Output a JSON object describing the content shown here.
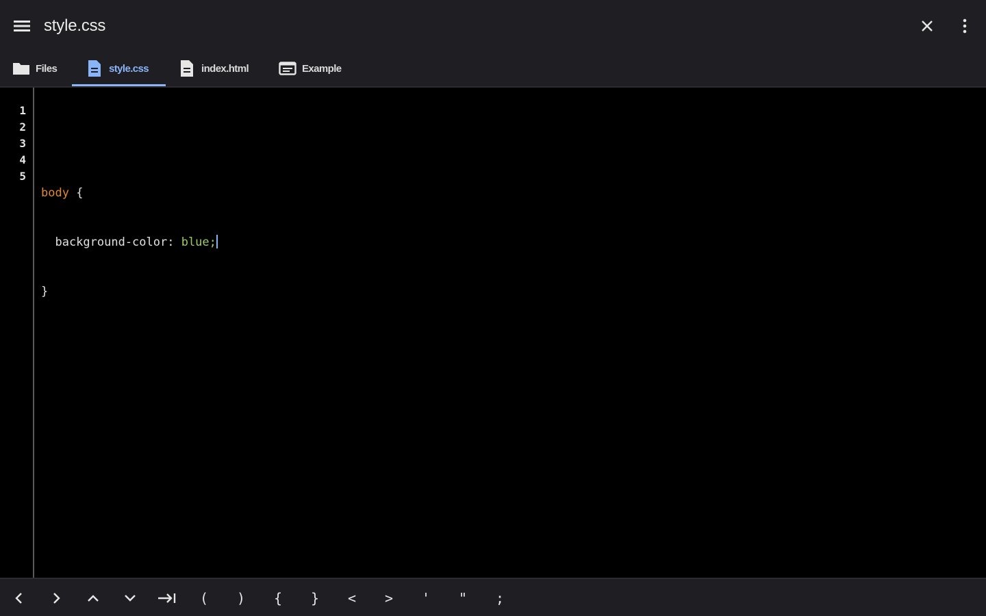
{
  "header": {
    "title": "style.css"
  },
  "tabs": [
    {
      "label": "Files",
      "icon": "folder-icon",
      "active": false
    },
    {
      "label": "style.css",
      "icon": "file-icon",
      "active": true
    },
    {
      "label": "index.html",
      "icon": "file-icon",
      "active": false
    },
    {
      "label": "Example",
      "icon": "preview-icon",
      "active": false
    }
  ],
  "editor": {
    "line_numbers": [
      "1",
      "2",
      "3",
      "4",
      "5"
    ],
    "code": {
      "line2_selector": "body",
      "line2_brace": " {",
      "line3_property": "  background-color: ",
      "line3_value": "blue;",
      "line4_brace": "}"
    }
  },
  "symbolbar": {
    "keys": [
      "left-arrow",
      "right-arrow",
      "up-arrow",
      "down-arrow",
      "tab",
      "(",
      ")",
      "{",
      "}",
      "<",
      ">",
      "'",
      "\"",
      ";"
    ]
  },
  "colors": {
    "header_bg": "#1f1f23",
    "editor_bg": "#000000",
    "accent": "#8ab4f8",
    "selector": "#e08a2c",
    "value": "#9ccc65"
  }
}
